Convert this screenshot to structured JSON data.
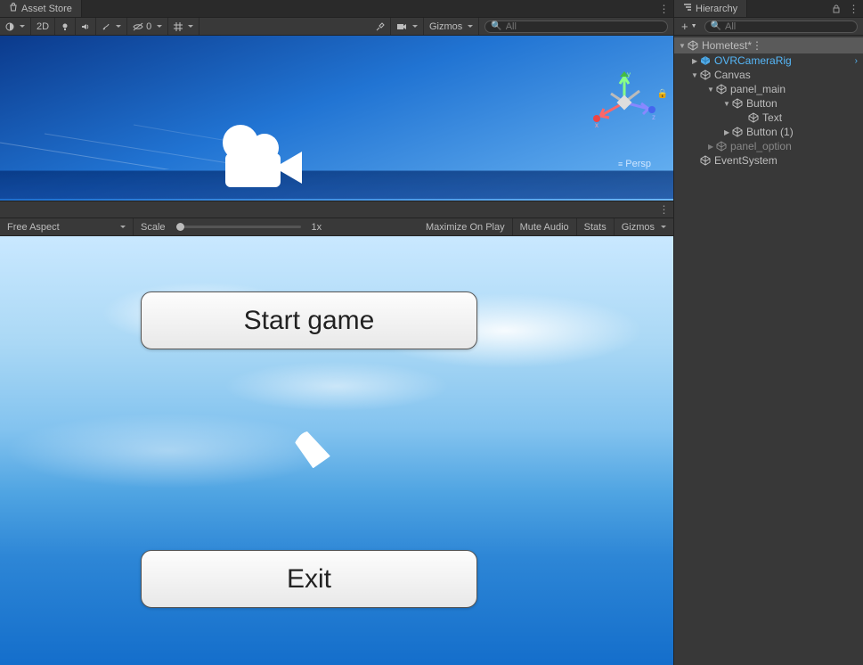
{
  "left": {
    "assetStoreTab": "Asset Store",
    "sceneToolbar": {
      "mode2d": "2D",
      "layersCount": "0",
      "gizmos": "Gizmos",
      "searchPlaceholder": "All"
    },
    "scene": {
      "perspLabel": "Persp",
      "axis": {
        "x": "x",
        "y": "y",
        "z": "z"
      }
    },
    "gameToolbar": {
      "aspect": "Free Aspect",
      "scaleLabel": "Scale",
      "scaleValue": "1x",
      "maximize": "Maximize On Play",
      "muteAudio": "Mute Audio",
      "stats": "Stats",
      "gizmos": "Gizmos"
    },
    "game": {
      "button1": "Start game",
      "button2": "Exit"
    }
  },
  "right": {
    "hierarchyTab": "Hierarchy",
    "searchPlaceholder": "All",
    "tree": {
      "scene": "Hometest*",
      "ovr": "OVRCameraRig",
      "canvas": "Canvas",
      "panelMain": "panel_main",
      "button": "Button",
      "text": "Text",
      "button1": "Button (1)",
      "panelOption": "panel_option",
      "eventSystem": "EventSystem"
    }
  }
}
